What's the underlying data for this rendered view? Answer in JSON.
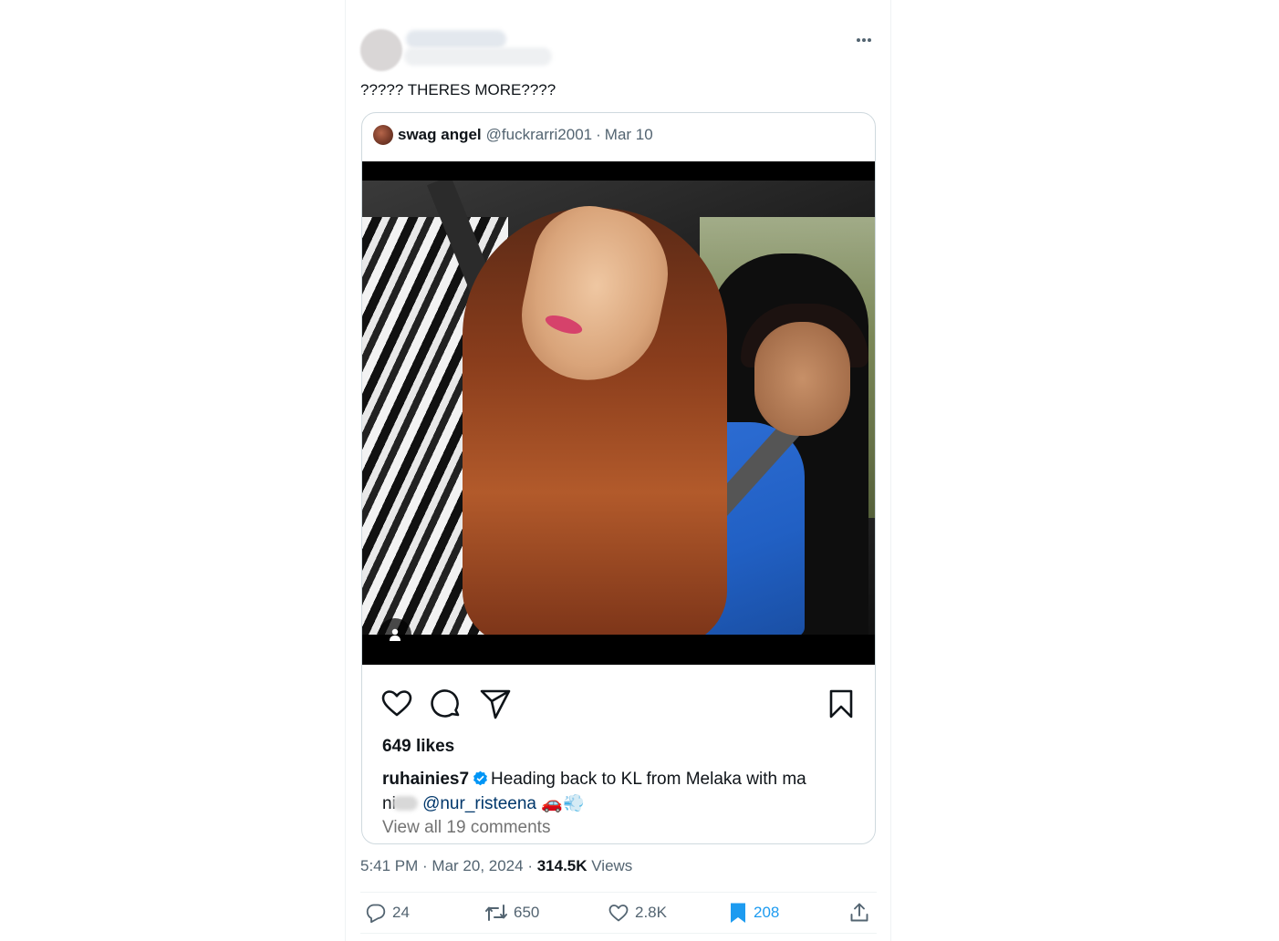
{
  "tweet": {
    "text": "????? THERES MORE????",
    "timestamp": "5:41 PM · Mar 20, 2024",
    "views_sep": " · ",
    "views_count": "314.5K",
    "views_label": "Views",
    "more_icon": "more-dots-icon"
  },
  "quote": {
    "display_name": "swag angel",
    "handle": "@fuckrarri2001",
    "dot": "·",
    "date": "Mar 10"
  },
  "instagram": {
    "likes": "649 likes",
    "username": "ruhainies7",
    "caption_text": "Heading back to KL from Melaka with ma",
    "caption_line2_prefix": "ni",
    "mention": "@nur_risteena",
    "emojis": "🚗💨",
    "view_all": "View all 19 comments",
    "icons": [
      "heart-icon",
      "comment-icon",
      "share-icon",
      "save-icon",
      "tag-user-icon"
    ]
  },
  "actions": {
    "replies": "24",
    "retweets": "650",
    "likes": "2.8K",
    "bookmarks": "208",
    "accent_color": "#1d9bf0"
  }
}
